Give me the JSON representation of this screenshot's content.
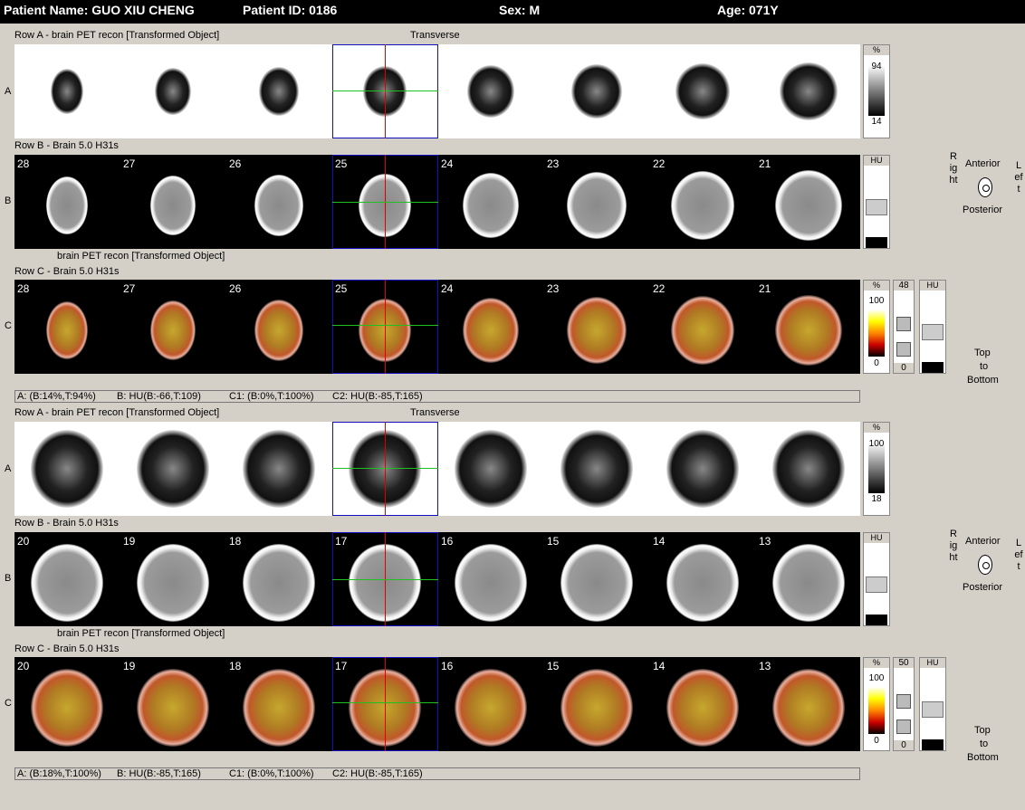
{
  "header": {
    "patient_name": "Patient Name:  GUO XIU CHENG",
    "patient_id": "Patient ID: 0186",
    "sex": "Sex:  M",
    "age": "Age: 071Y"
  },
  "panels": [
    {
      "rowA_label": "Row A - brain PET recon [Transformed Object]",
      "orientation_label": "Transverse",
      "rowB_label": "Row B - Brain  5.0  H31s",
      "rowC_prefix": "brain PET recon [Transformed Object]",
      "rowC_label": "Row C - Brain  5.0  H31s",
      "slices": [
        "28",
        "27",
        "26",
        "25",
        "24",
        "23",
        "22",
        "21"
      ],
      "pet_scale": {
        "unit": "%",
        "max": "94",
        "min": "14"
      },
      "fusion_scale": {
        "unit": "%",
        "max": "100",
        "min": "0"
      },
      "fusion_slider": {
        "top": "48",
        "bottom": "0"
      },
      "hu_label": "HU",
      "status": {
        "a": "A: (B:14%,T:94%)",
        "b": "B: HU(B:-66,T:109)",
        "c1": "C1: (B:0%,T:100%)",
        "c2": "C2: HU(B:-85,T:165)"
      }
    },
    {
      "rowA_label": "Row A - brain PET recon [Transformed Object]",
      "orientation_label": "Transverse",
      "rowB_label": "Row B - Brain  5.0  H31s",
      "rowC_prefix": "brain PET recon [Transformed Object]",
      "rowC_label": "Row C - Brain  5.0  H31s",
      "slices": [
        "20",
        "19",
        "18",
        "17",
        "16",
        "15",
        "14",
        "13"
      ],
      "pet_scale": {
        "unit": "%",
        "max": "100",
        "min": "18"
      },
      "fusion_scale": {
        "unit": "%",
        "max": "100",
        "min": "0"
      },
      "fusion_slider": {
        "top": "50",
        "bottom": "0"
      },
      "hu_label": "HU",
      "status": {
        "a": "A: (B:18%,T:100%)",
        "b": "B: HU(B:-85,T:165)",
        "c1": "C1: (B:0%,T:100%)",
        "c2": "C2: HU(B:-85,T:165)"
      }
    }
  ],
  "row_letters": {
    "a": "A",
    "b": "B",
    "c": "C"
  },
  "orientation": {
    "anterior": "Anterior",
    "posterior": "Posterior",
    "right": "Right",
    "left": "Left",
    "top": "Top",
    "to": "to",
    "bottom": "Bottom"
  },
  "colors": {
    "header_bg": "#000000",
    "crosshair_v": "#e00000",
    "crosshair_h": "#20c020",
    "selected_box": "#1010c0"
  }
}
